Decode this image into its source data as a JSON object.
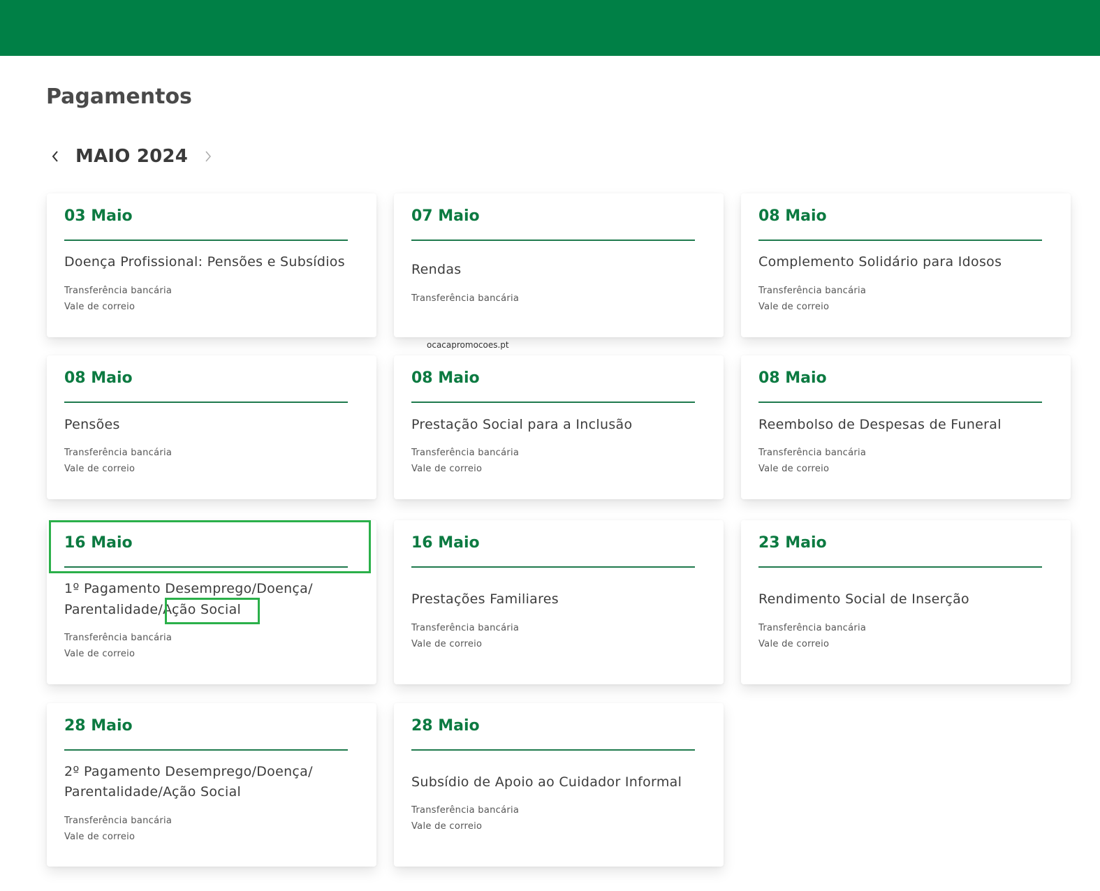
{
  "header": {
    "bar_color": "#008046"
  },
  "page": {
    "title": "Pagamentos"
  },
  "month_nav": {
    "label": "MAIO 2024",
    "prev_icon": "chevron-left-icon",
    "next_icon": "chevron-right-icon"
  },
  "watermark": "ocacapromocoes.pt",
  "cards": [
    {
      "date": "03 Maio",
      "title": "Doença Profissional: Pensões e Subsídios",
      "methods": [
        "Transferência bancária",
        "Vale de correio"
      ]
    },
    {
      "date": "07 Maio",
      "title": "Rendas",
      "methods": [
        "Transferência bancária"
      ]
    },
    {
      "date": "08 Maio",
      "title": "Complemento Solidário para Idosos",
      "methods": [
        "Transferência bancária",
        "Vale de correio"
      ]
    },
    {
      "date": "08 Maio",
      "title": "Pensões",
      "methods": [
        "Transferência bancária",
        "Vale de correio"
      ]
    },
    {
      "date": "08 Maio",
      "title": "Prestação Social para a Inclusão",
      "methods": [
        "Transferência bancária",
        "Vale de correio"
      ]
    },
    {
      "date": "08 Maio",
      "title": "Reembolso de Despesas de Funeral",
      "methods": [
        "Transferência bancária",
        "Vale de correio"
      ]
    },
    {
      "date": "16 Maio",
      "title_line1": "1º Pagamento Desemprego/Doença/",
      "title_line2": "Parentalidade/Ação Social",
      "methods": [
        "Transferência bancária",
        "Vale de correio"
      ]
    },
    {
      "date": "16 Maio",
      "title": "Prestações Familiares",
      "methods": [
        "Transferência bancária",
        "Vale de correio"
      ]
    },
    {
      "date": "23 Maio",
      "title": "Rendimento Social de Inserção",
      "methods": [
        "Transferência bancária",
        "Vale de correio"
      ]
    },
    {
      "date": "28 Maio",
      "title_line1": "2º Pagamento Desemprego/Doença/",
      "title_line2": "Parentalidade/Ação Social",
      "methods": [
        "Transferência bancária",
        "Vale de correio"
      ]
    },
    {
      "date": "28 Maio",
      "title": "Subsídio de Apoio ao Cuidador Informal",
      "methods": [
        "Transferência bancária",
        "Vale de correio"
      ]
    }
  ],
  "highlight_color": "#2bb04a"
}
